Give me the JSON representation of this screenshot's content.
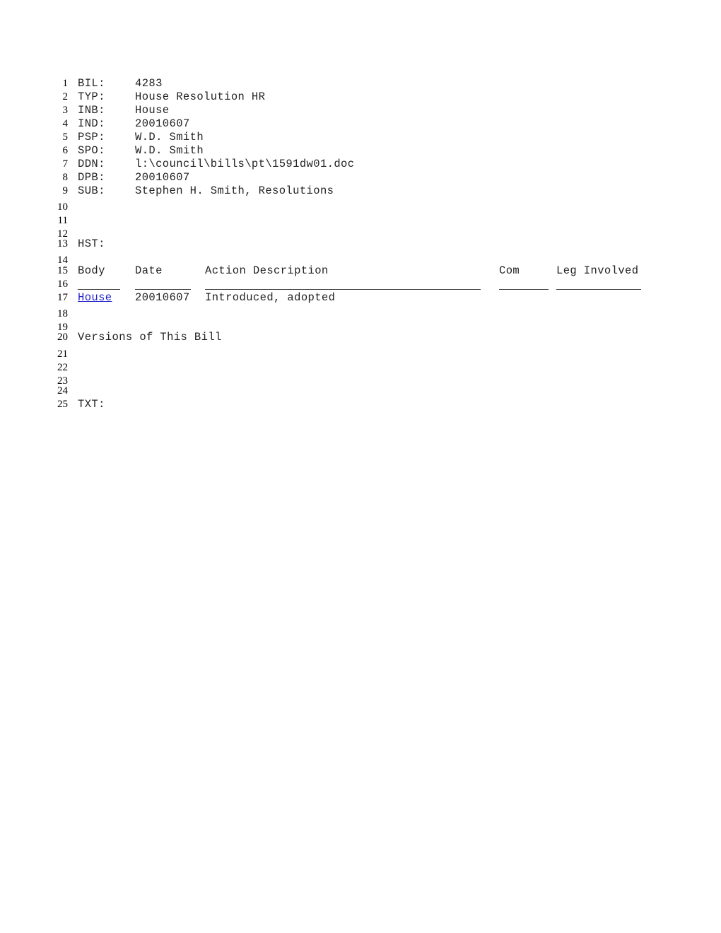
{
  "fields": [
    {
      "line": "1",
      "label": "BIL:",
      "value": "4283"
    },
    {
      "line": "2",
      "label": "TYP:",
      "value": "House Resolution HR"
    },
    {
      "line": "3",
      "label": "INB:",
      "value": "House"
    },
    {
      "line": "4",
      "label": "IND:",
      "value": "20010607"
    },
    {
      "line": "5",
      "label": "PSP:",
      "value": "W.D. Smith"
    },
    {
      "line": "6",
      "label": "SPO:",
      "value": "W.D. Smith"
    },
    {
      "line": "7",
      "label": "DDN:",
      "value": "l:\\council\\bills\\pt\\1591dw01.doc"
    },
    {
      "line": "8",
      "label": "DPB:",
      "value": "20010607"
    },
    {
      "line": "9",
      "label": "SUB:",
      "value": "Stephen H. Smith, Resolutions"
    }
  ],
  "empty_lines": [
    "10",
    "11",
    "12",
    "14",
    "16",
    "18",
    "19",
    "21",
    "22",
    "23",
    "24"
  ],
  "history": {
    "line": "13",
    "label": "HST:",
    "header_line": "15",
    "columns": [
      "Body",
      "Date",
      "Action Description",
      "Com",
      "Leg Involved"
    ],
    "rows": [
      {
        "line": "17",
        "body": "House",
        "date": "20010607",
        "action": "Introduced, adopted",
        "com": "",
        "leg": ""
      }
    ]
  },
  "versions": {
    "line": "20",
    "label": "Versions of This Bill"
  },
  "text": {
    "line": "25",
    "label": "TXT:"
  },
  "colors": {
    "link": "#2222cc"
  }
}
